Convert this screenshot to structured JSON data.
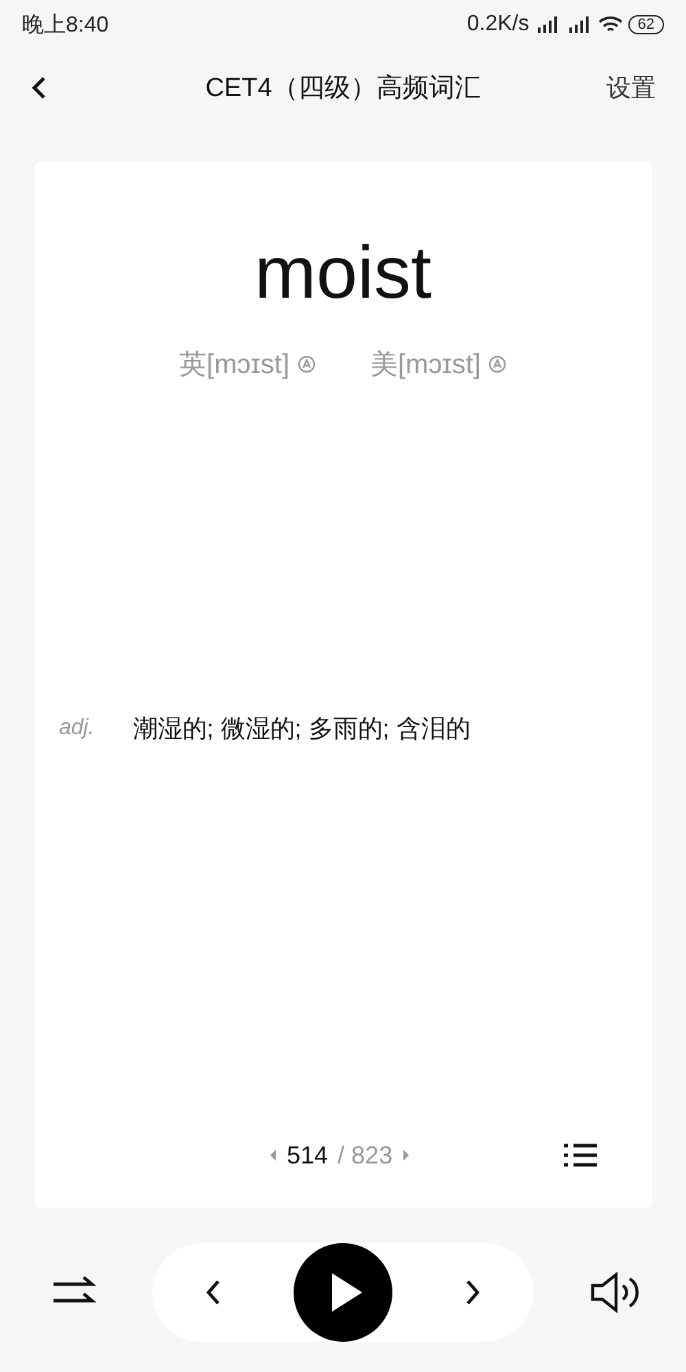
{
  "status_bar": {
    "time": "晚上8:40",
    "speed": "0.2K/s",
    "battery": "62"
  },
  "header": {
    "title": "CET4（四级）高频词汇",
    "settings": "设置"
  },
  "card": {
    "word": "moist",
    "pronunciations": [
      {
        "label": "英[mɔɪst]"
      },
      {
        "label": "美[mɔɪst]"
      }
    ],
    "definitions": [
      {
        "pos": "adj.",
        "meaning": "潮湿的; 微湿的; 多雨的; 含泪的"
      }
    ],
    "pager": {
      "current": "514",
      "total": "/ 823"
    }
  }
}
